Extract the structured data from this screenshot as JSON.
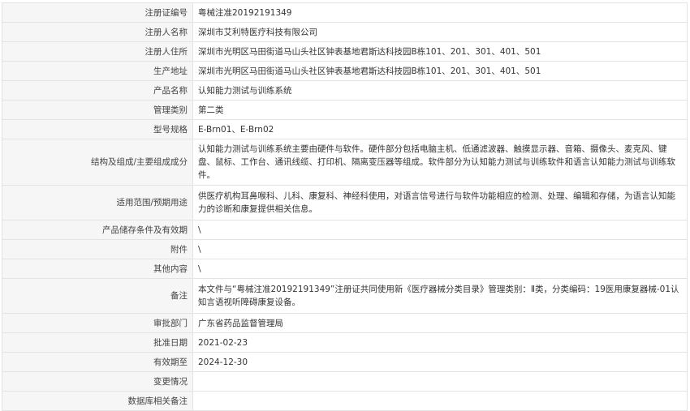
{
  "rows": [
    {
      "label": "注册证编号",
      "value": "粤械注准20192191349"
    },
    {
      "label": "注册人名称",
      "value": "深圳市艾利特医疗科技有限公司"
    },
    {
      "label": "注册人住所",
      "value": "深圳市光明区马田街道马山头社区钟表基地君斯达科技园B栋101、201、301、401、501"
    },
    {
      "label": "生产地址",
      "value": "深圳市光明区马田街道马山头社区钟表基地君斯达科技园B栋101、201、301、401、501"
    },
    {
      "label": "产品名称",
      "value": "认知能力测试与训练系统"
    },
    {
      "label": "管理类别",
      "value": "第二类"
    },
    {
      "label": "型号规格",
      "value": "E-Brn01、E-Brn02"
    },
    {
      "label": "结构及组成/主要组成成分",
      "value": "认知能力测试与训练系统主要由硬件与软件。硬件部分包括电脑主机、低通滤波器、触摸显示器、音箱、摄像头、麦克风、键盘、鼠标、工作台、通讯线缆、打印机、隔离变压器等组成。软件部分为认知能力测试与训练软件和语言认知能力测试与训练软件。"
    },
    {
      "label": "适用范围/预期用途",
      "value": "供医疗机构耳鼻喉科、儿科、康复科、神经科使用，对语言信号进行与软件功能相应的检测、处理、编辑和存储，为语言认知能力的诊断和康复提供相关信息。"
    },
    {
      "label": "产品储存条件及有效期",
      "value": "\\"
    },
    {
      "label": "附件",
      "value": "\\"
    },
    {
      "label": "其他内容",
      "value": "\\"
    },
    {
      "label": "备注",
      "value": "本文件与“粤械注准20192191349”注册证共同使用新《医疗器械分类目录》管理类别：Ⅱ类，分类编码：19医用康复器械-01认知言语视听障碍康复设备。"
    },
    {
      "label": "审批部门",
      "value": "广东省药品监督管理局"
    },
    {
      "label": "批准日期",
      "value": "2021-02-23"
    },
    {
      "label": "有效期至",
      "value": "2024-12-30"
    },
    {
      "label": "变更情况",
      "value": ""
    },
    {
      "label": "数据库相关备注",
      "value": ""
    }
  ]
}
